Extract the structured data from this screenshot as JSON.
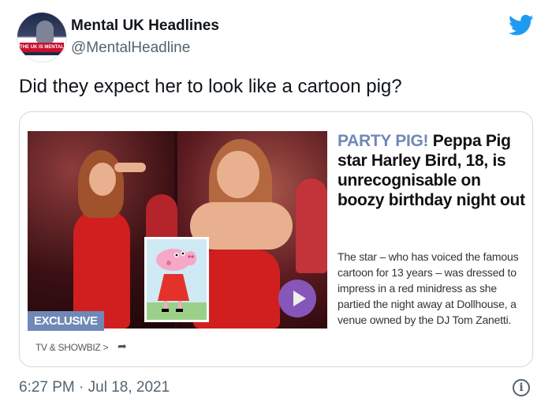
{
  "tweet": {
    "author": {
      "display_name": "Mental UK Headlines",
      "handle": "@MentalHeadline",
      "avatar_banner": "THE UK IS MENTAL"
    },
    "text": "Did they expect her to look like a cartoon pig?",
    "timestamp": "6:27 PM · Jul 18, 2021",
    "brand_icon": "twitter-bird-icon",
    "accent_color": "#1d9bf0",
    "info_icon": "info-icon",
    "info_glyph": "i"
  },
  "article_card": {
    "badge": "EXCLUSIVE",
    "section": "TV & SHOWBIZ >",
    "share_icon": "share-arrow-icon",
    "share_glyph": "➦",
    "play_icon": "play-icon",
    "headline_kicker": "PARTY PIG!",
    "headline_rest": "Peppa Pig star Harley Bird, 18, is unrecognisable on boozy birthday night out",
    "standfirst": "The star –  who has voiced the famous cartoon for 13 years – was dressed to impress in a red minidress as she partied the night away at Dollhouse, a venue owned by the DJ Tom Zanetti.",
    "kicker_color": "#6f89b7"
  }
}
